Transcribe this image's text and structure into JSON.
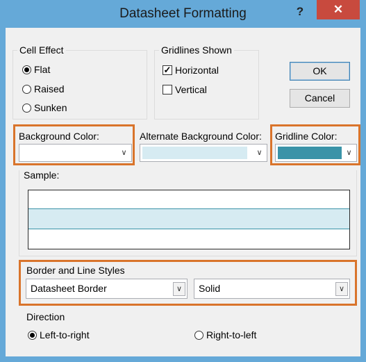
{
  "window": {
    "title": "Datasheet Formatting",
    "help_label": "?",
    "close_label": "✕"
  },
  "cell_effect": {
    "legend": "Cell Effect",
    "options": [
      {
        "label": "Flat",
        "selected": true
      },
      {
        "label": "Raised",
        "selected": false
      },
      {
        "label": "Sunken",
        "selected": false
      }
    ]
  },
  "gridlines_shown": {
    "legend": "Gridlines Shown",
    "horizontal": {
      "label": "Horizontal",
      "checked": true,
      "mark": "✓"
    },
    "vertical": {
      "label": "Vertical",
      "checked": false
    }
  },
  "buttons": {
    "ok": "OK",
    "cancel": "Cancel"
  },
  "background_color": {
    "label": "Background Color:",
    "value": "#ffffff"
  },
  "alternate_background_color": {
    "label": "Alternate Background Color:",
    "value": "#d6ebf2"
  },
  "gridline_color": {
    "label": "Gridline Color:",
    "value": "#3a93a8"
  },
  "sample": {
    "label": "Sample:"
  },
  "border_line_styles": {
    "legend": "Border and Line Styles",
    "border_select": "Datasheet Border",
    "line_select": "Solid"
  },
  "direction": {
    "legend": "Direction",
    "left_to_right": {
      "label": "Left-to-right",
      "selected": true
    },
    "right_to_left": {
      "label": "Right-to-left",
      "selected": false
    }
  },
  "colors": {
    "highlight": "#d9742b",
    "title_bar": "#65a9d8",
    "close": "#c84a3e"
  },
  "icons": {
    "dropdown": "chevron-down-icon",
    "help": "help-icon",
    "close": "close-icon"
  }
}
